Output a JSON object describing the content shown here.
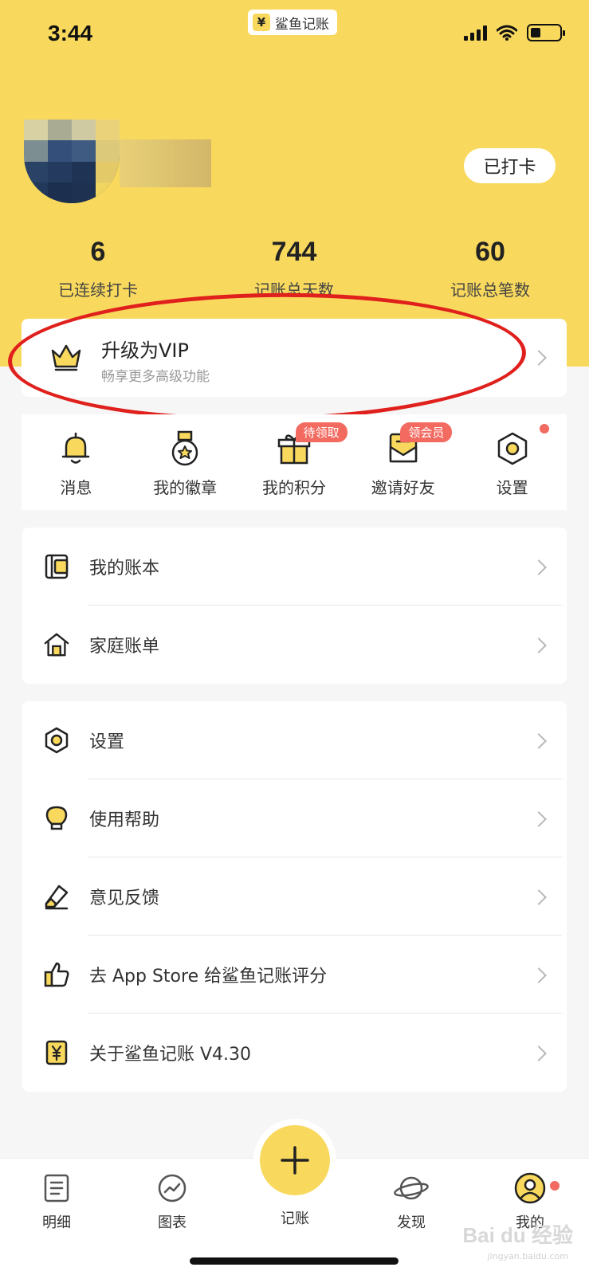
{
  "status_bar": {
    "time": "3:44",
    "app_badge_icon": "¥",
    "app_badge_label": "鲨鱼记账",
    "battery_level": 0.25
  },
  "profile": {
    "checkin_label": "已打卡"
  },
  "stats": [
    {
      "value": "6",
      "label": "已连续打卡"
    },
    {
      "value": "744",
      "label": "记账总天数"
    },
    {
      "value": "60",
      "label": "记账总笔数"
    }
  ],
  "vip": {
    "title": "升级为VIP",
    "subtitle": "畅享更多高级功能",
    "icon": "crown-icon"
  },
  "quick_actions": [
    {
      "label": "消息",
      "icon": "bell-icon"
    },
    {
      "label": "我的徽章",
      "icon": "medal-icon"
    },
    {
      "label": "我的积分",
      "icon": "gift-icon",
      "badge": "待领取"
    },
    {
      "label": "邀请好友",
      "icon": "envelope-icon",
      "badge": "领会员"
    },
    {
      "label": "设置",
      "icon": "settings-icon"
    }
  ],
  "menu_group_1": [
    {
      "label": "我的账本",
      "icon": "wallet-icon"
    },
    {
      "label": "家庭账单",
      "icon": "house-icon"
    }
  ],
  "menu_group_2": [
    {
      "label": "设置",
      "icon": "settings-icon"
    },
    {
      "label": "使用帮助",
      "icon": "lightbulb-icon"
    },
    {
      "label": "意见反馈",
      "icon": "pencil-icon"
    },
    {
      "label": "去 App Store 给鲨鱼记账评分",
      "icon": "thumbs-up-icon"
    },
    {
      "label": "关于鲨鱼记账 V4.30",
      "icon": "yen-icon"
    }
  ],
  "tab_bar": [
    {
      "label": "明细",
      "icon": "document-icon"
    },
    {
      "label": "图表",
      "icon": "chart-icon"
    },
    {
      "label": "记账",
      "icon": "plus-icon"
    },
    {
      "label": "发现",
      "icon": "planet-icon"
    },
    {
      "label": "我的",
      "icon": "user-icon"
    }
  ],
  "watermark": {
    "text": "Bai du 经验",
    "sub": "jingyan.baidu.com"
  },
  "colors": {
    "brand_yellow": "#f9d95d",
    "badge_red": "#f26a60",
    "annotation_red": "#e0201c"
  }
}
